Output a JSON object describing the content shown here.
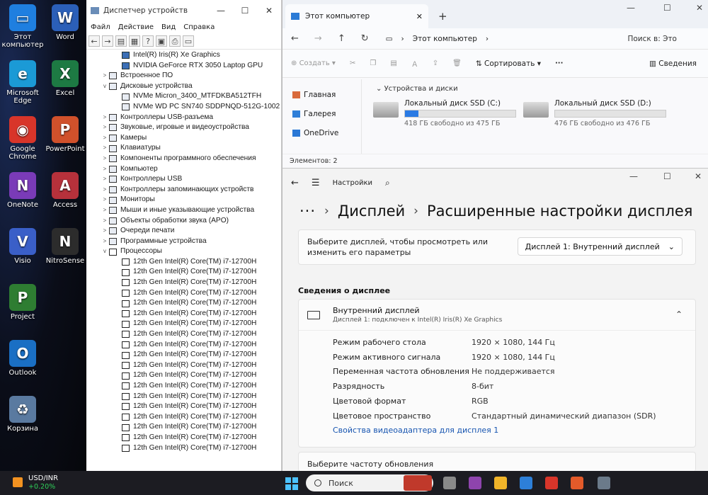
{
  "desktop": {
    "icons": [
      {
        "label": "Этот\nкомпьютер",
        "glyph": "▭",
        "color": "#1f7fe0",
        "icon": "this-pc-icon"
      },
      {
        "label": "Word",
        "glyph": "W",
        "color": "#2b5fb8",
        "icon": "word-icon"
      },
      {
        "label": "Microsoft\nEdge",
        "glyph": "e",
        "color": "#1b9ad6",
        "icon": "edge-icon"
      },
      {
        "label": "Excel",
        "glyph": "X",
        "color": "#1d7a43",
        "icon": "excel-icon"
      },
      {
        "label": "Google\nChrome",
        "glyph": "◉",
        "color": "#d8352a",
        "icon": "chrome-icon"
      },
      {
        "label": "PowerPoint",
        "glyph": "P",
        "color": "#d0512b",
        "icon": "powerpoint-icon"
      },
      {
        "label": "OneNote",
        "glyph": "N",
        "color": "#7a3bb8",
        "icon": "onenote-icon"
      },
      {
        "label": "Access",
        "glyph": "A",
        "color": "#b6313b",
        "icon": "access-icon"
      },
      {
        "label": "Visio",
        "glyph": "V",
        "color": "#3a5fc8",
        "icon": "visio-icon"
      },
      {
        "label": "NitroSense",
        "glyph": "N",
        "color": "#2c2c2c",
        "icon": "nitrosense-icon"
      },
      {
        "label": "Project",
        "glyph": "P",
        "color": "#2e7d32",
        "icon": "project-icon"
      },
      {
        "label": "",
        "glyph": "",
        "color": "transparent",
        "icon": "empty"
      },
      {
        "label": "Outlook",
        "glyph": "O",
        "color": "#1a6fc4",
        "icon": "outlook-icon"
      },
      {
        "label": "",
        "glyph": "",
        "color": "transparent",
        "icon": "empty"
      },
      {
        "label": "Корзина",
        "glyph": "♻",
        "color": "#5a7aa0",
        "icon": "recycle-bin-icon"
      }
    ]
  },
  "devmgr": {
    "title": "Диспетчер устройств",
    "menu": [
      "Файл",
      "Действие",
      "Вид",
      "Справка"
    ],
    "tree": [
      {
        "label": "Intel(R) Iris(R) Xe Graphics",
        "indent": 2,
        "arrow": "",
        "ico": "disp"
      },
      {
        "label": "NVIDIA GeForce RTX 3050 Laptop GPU",
        "indent": 2,
        "arrow": "",
        "ico": "disp"
      },
      {
        "label": "Встроенное ПО",
        "indent": 1,
        "arrow": ">",
        "ico": ""
      },
      {
        "label": "Дисковые устройства",
        "indent": 1,
        "arrow": "v",
        "ico": ""
      },
      {
        "label": "NVMe Micron_3400_MTFDKBA512TFH",
        "indent": 2,
        "arrow": "",
        "ico": ""
      },
      {
        "label": "NVMe WD PC SN740 SDDPNQD-512G-1002",
        "indent": 2,
        "arrow": "",
        "ico": ""
      },
      {
        "label": "Контроллеры USB-разъема",
        "indent": 1,
        "arrow": ">",
        "ico": ""
      },
      {
        "label": "Звуковые, игровые и видеоустройства",
        "indent": 1,
        "arrow": ">",
        "ico": ""
      },
      {
        "label": "Камеры",
        "indent": 1,
        "arrow": ">",
        "ico": ""
      },
      {
        "label": "Клавиатуры",
        "indent": 1,
        "arrow": ">",
        "ico": ""
      },
      {
        "label": "Компоненты программного обеспечения",
        "indent": 1,
        "arrow": ">",
        "ico": ""
      },
      {
        "label": "Компьютер",
        "indent": 1,
        "arrow": ">",
        "ico": ""
      },
      {
        "label": "Контроллеры USB",
        "indent": 1,
        "arrow": ">",
        "ico": ""
      },
      {
        "label": "Контроллеры запоминающих устройств",
        "indent": 1,
        "arrow": ">",
        "ico": ""
      },
      {
        "label": "Мониторы",
        "indent": 1,
        "arrow": ">",
        "ico": ""
      },
      {
        "label": "Мыши и иные указывающие устройства",
        "indent": 1,
        "arrow": ">",
        "ico": ""
      },
      {
        "label": "Объекты обработки звука (APO)",
        "indent": 1,
        "arrow": ">",
        "ico": ""
      },
      {
        "label": "Очереди печати",
        "indent": 1,
        "arrow": ">",
        "ico": ""
      },
      {
        "label": "Программные устройства",
        "indent": 1,
        "arrow": ">",
        "ico": ""
      },
      {
        "label": "Процессоры",
        "indent": 1,
        "arrow": "v",
        "ico": "cpu"
      },
      {
        "label": "12th Gen Intel(R) Core(TM) i7-12700H",
        "indent": 2,
        "arrow": "",
        "ico": "cpu"
      },
      {
        "label": "12th Gen Intel(R) Core(TM) i7-12700H",
        "indent": 2,
        "arrow": "",
        "ico": "cpu"
      },
      {
        "label": "12th Gen Intel(R) Core(TM) i7-12700H",
        "indent": 2,
        "arrow": "",
        "ico": "cpu"
      },
      {
        "label": "12th Gen Intel(R) Core(TM) i7-12700H",
        "indent": 2,
        "arrow": "",
        "ico": "cpu"
      },
      {
        "label": "12th Gen Intel(R) Core(TM) i7-12700H",
        "indent": 2,
        "arrow": "",
        "ico": "cpu"
      },
      {
        "label": "12th Gen Intel(R) Core(TM) i7-12700H",
        "indent": 2,
        "arrow": "",
        "ico": "cpu"
      },
      {
        "label": "12th Gen Intel(R) Core(TM) i7-12700H",
        "indent": 2,
        "arrow": "",
        "ico": "cpu"
      },
      {
        "label": "12th Gen Intel(R) Core(TM) i7-12700H",
        "indent": 2,
        "arrow": "",
        "ico": "cpu"
      },
      {
        "label": "12th Gen Intel(R) Core(TM) i7-12700H",
        "indent": 2,
        "arrow": "",
        "ico": "cpu"
      },
      {
        "label": "12th Gen Intel(R) Core(TM) i7-12700H",
        "indent": 2,
        "arrow": "",
        "ico": "cpu"
      },
      {
        "label": "12th Gen Intel(R) Core(TM) i7-12700H",
        "indent": 2,
        "arrow": "",
        "ico": "cpu"
      },
      {
        "label": "12th Gen Intel(R) Core(TM) i7-12700H",
        "indent": 2,
        "arrow": "",
        "ico": "cpu"
      },
      {
        "label": "12th Gen Intel(R) Core(TM) i7-12700H",
        "indent": 2,
        "arrow": "",
        "ico": "cpu"
      },
      {
        "label": "12th Gen Intel(R) Core(TM) i7-12700H",
        "indent": 2,
        "arrow": "",
        "ico": "cpu"
      },
      {
        "label": "12th Gen Intel(R) Core(TM) i7-12700H",
        "indent": 2,
        "arrow": "",
        "ico": "cpu"
      },
      {
        "label": "12th Gen Intel(R) Core(TM) i7-12700H",
        "indent": 2,
        "arrow": "",
        "ico": "cpu"
      },
      {
        "label": "12th Gen Intel(R) Core(TM) i7-12700H",
        "indent": 2,
        "arrow": "",
        "ico": "cpu"
      },
      {
        "label": "12th Gen Intel(R) Core(TM) i7-12700H",
        "indent": 2,
        "arrow": "",
        "ico": "cpu"
      },
      {
        "label": "12th Gen Intel(R) Core(TM) i7-12700H",
        "indent": 2,
        "arrow": "",
        "ico": "cpu"
      }
    ]
  },
  "explorer": {
    "tab_title": "Этот компьютер",
    "address": "Этот компьютер",
    "search_placeholder": "Поиск в: Это",
    "cmd_create": "Создать",
    "cmd_sort": "Сортировать",
    "cmd_more": "···",
    "cmd_details": "Сведения",
    "sidebar": [
      {
        "label": "Главная",
        "icon": "home-icon",
        "color": "#d96a3a"
      },
      {
        "label": "Галерея",
        "icon": "gallery-icon",
        "color": "#2f7fd8"
      },
      {
        "label": "OneDrive",
        "icon": "onedrive-icon",
        "color": "#2a78d6"
      }
    ],
    "group_label": "Устройства и диски",
    "drives": [
      {
        "name": "Локальный диск SSD (C:)",
        "free": "418 ГБ свободно из 475 ГБ",
        "used_fraction": 0.12
      },
      {
        "name": "Локальный диск SSD (D:)",
        "free": "476 ГБ свободно из 476 ГБ",
        "used_fraction": 0.0
      }
    ],
    "status": "Элементов: 2"
  },
  "settings": {
    "app_title": "Настройки",
    "breadcrumb_parent": "Дисплей",
    "breadcrumb_current": "Расширенные настройки дисплея",
    "select_prompt": "Выберите дисплей, чтобы просмотреть или изменить его параметры",
    "select_value": "Дисплей 1: Внутренний дисплей",
    "section_title": "Сведения о дисплее",
    "display_name": "Внутренний дисплей",
    "display_sub": "Дисплей 1: подключен к Intel(R) Iris(R) Xe Graphics",
    "props": [
      {
        "k": "Режим рабочего стола",
        "v": "1920 × 1080, 144 Гц"
      },
      {
        "k": "Режим активного сигнала",
        "v": "1920 × 1080, 144 Гц"
      },
      {
        "k": "Переменная частота обновления",
        "v": "Не поддерживается"
      },
      {
        "k": "Разрядность",
        "v": "8-бит"
      },
      {
        "k": "Цветовой формат",
        "v": "RGB"
      },
      {
        "k": "Цветовое пространство",
        "v": "Стандартный динамический диапазон (SDR)"
      }
    ],
    "adapter_link": "Свойства видеоадаптера для дисплея 1",
    "refresh_label": "Выберите частоту обновления"
  },
  "taskbar": {
    "ticker": "USD/INR",
    "change": "+0.20%",
    "search_label": "Поиск",
    "apps": [
      {
        "icon": "game-icon",
        "color": "#c0392b"
      },
      {
        "icon": "task-view-icon",
        "color": "#8a8a8a"
      },
      {
        "icon": "copilot-icon",
        "color": "#8e44ad"
      },
      {
        "icon": "file-explorer-icon",
        "color": "#f0b429"
      },
      {
        "icon": "store-icon",
        "color": "#2d7fd8"
      },
      {
        "icon": "chrome-icon",
        "color": "#d8352a"
      },
      {
        "icon": "app-icon",
        "color": "#e35a2a"
      },
      {
        "icon": "settings-icon",
        "color": "#6b7a8a"
      }
    ]
  }
}
